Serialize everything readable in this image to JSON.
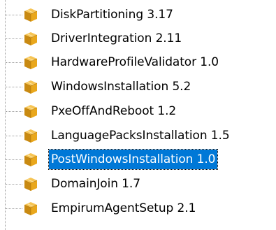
{
  "tree": {
    "items": [
      {
        "label": "DiskPartitioning 3.17",
        "icon": "package-icon",
        "selected": false
      },
      {
        "label": "DriverIntegration 2.11",
        "icon": "package-icon",
        "selected": false
      },
      {
        "label": "HardwareProfileValidator 1.0",
        "icon": "package-icon",
        "selected": false
      },
      {
        "label": "WindowsInstallation 5.2",
        "icon": "package-icon",
        "selected": false
      },
      {
        "label": "PxeOffAndReboot 1.2",
        "icon": "package-icon",
        "selected": false
      },
      {
        "label": "LanguagePacksInstallation 1.5",
        "icon": "package-icon",
        "selected": false
      },
      {
        "label": "PostWindowsInstallation 1.0",
        "icon": "package-icon",
        "selected": true
      },
      {
        "label": "DomainJoin 1.7",
        "icon": "package-icon",
        "selected": false
      },
      {
        "label": "EmpirumAgentSetup 2.1",
        "icon": "package-icon",
        "selected": false
      }
    ]
  },
  "colors": {
    "selection_background": "#0078d7",
    "selection_text": "#ffffff",
    "connector_lines": "#a0a0a0",
    "package_icon": "#f0b429"
  }
}
